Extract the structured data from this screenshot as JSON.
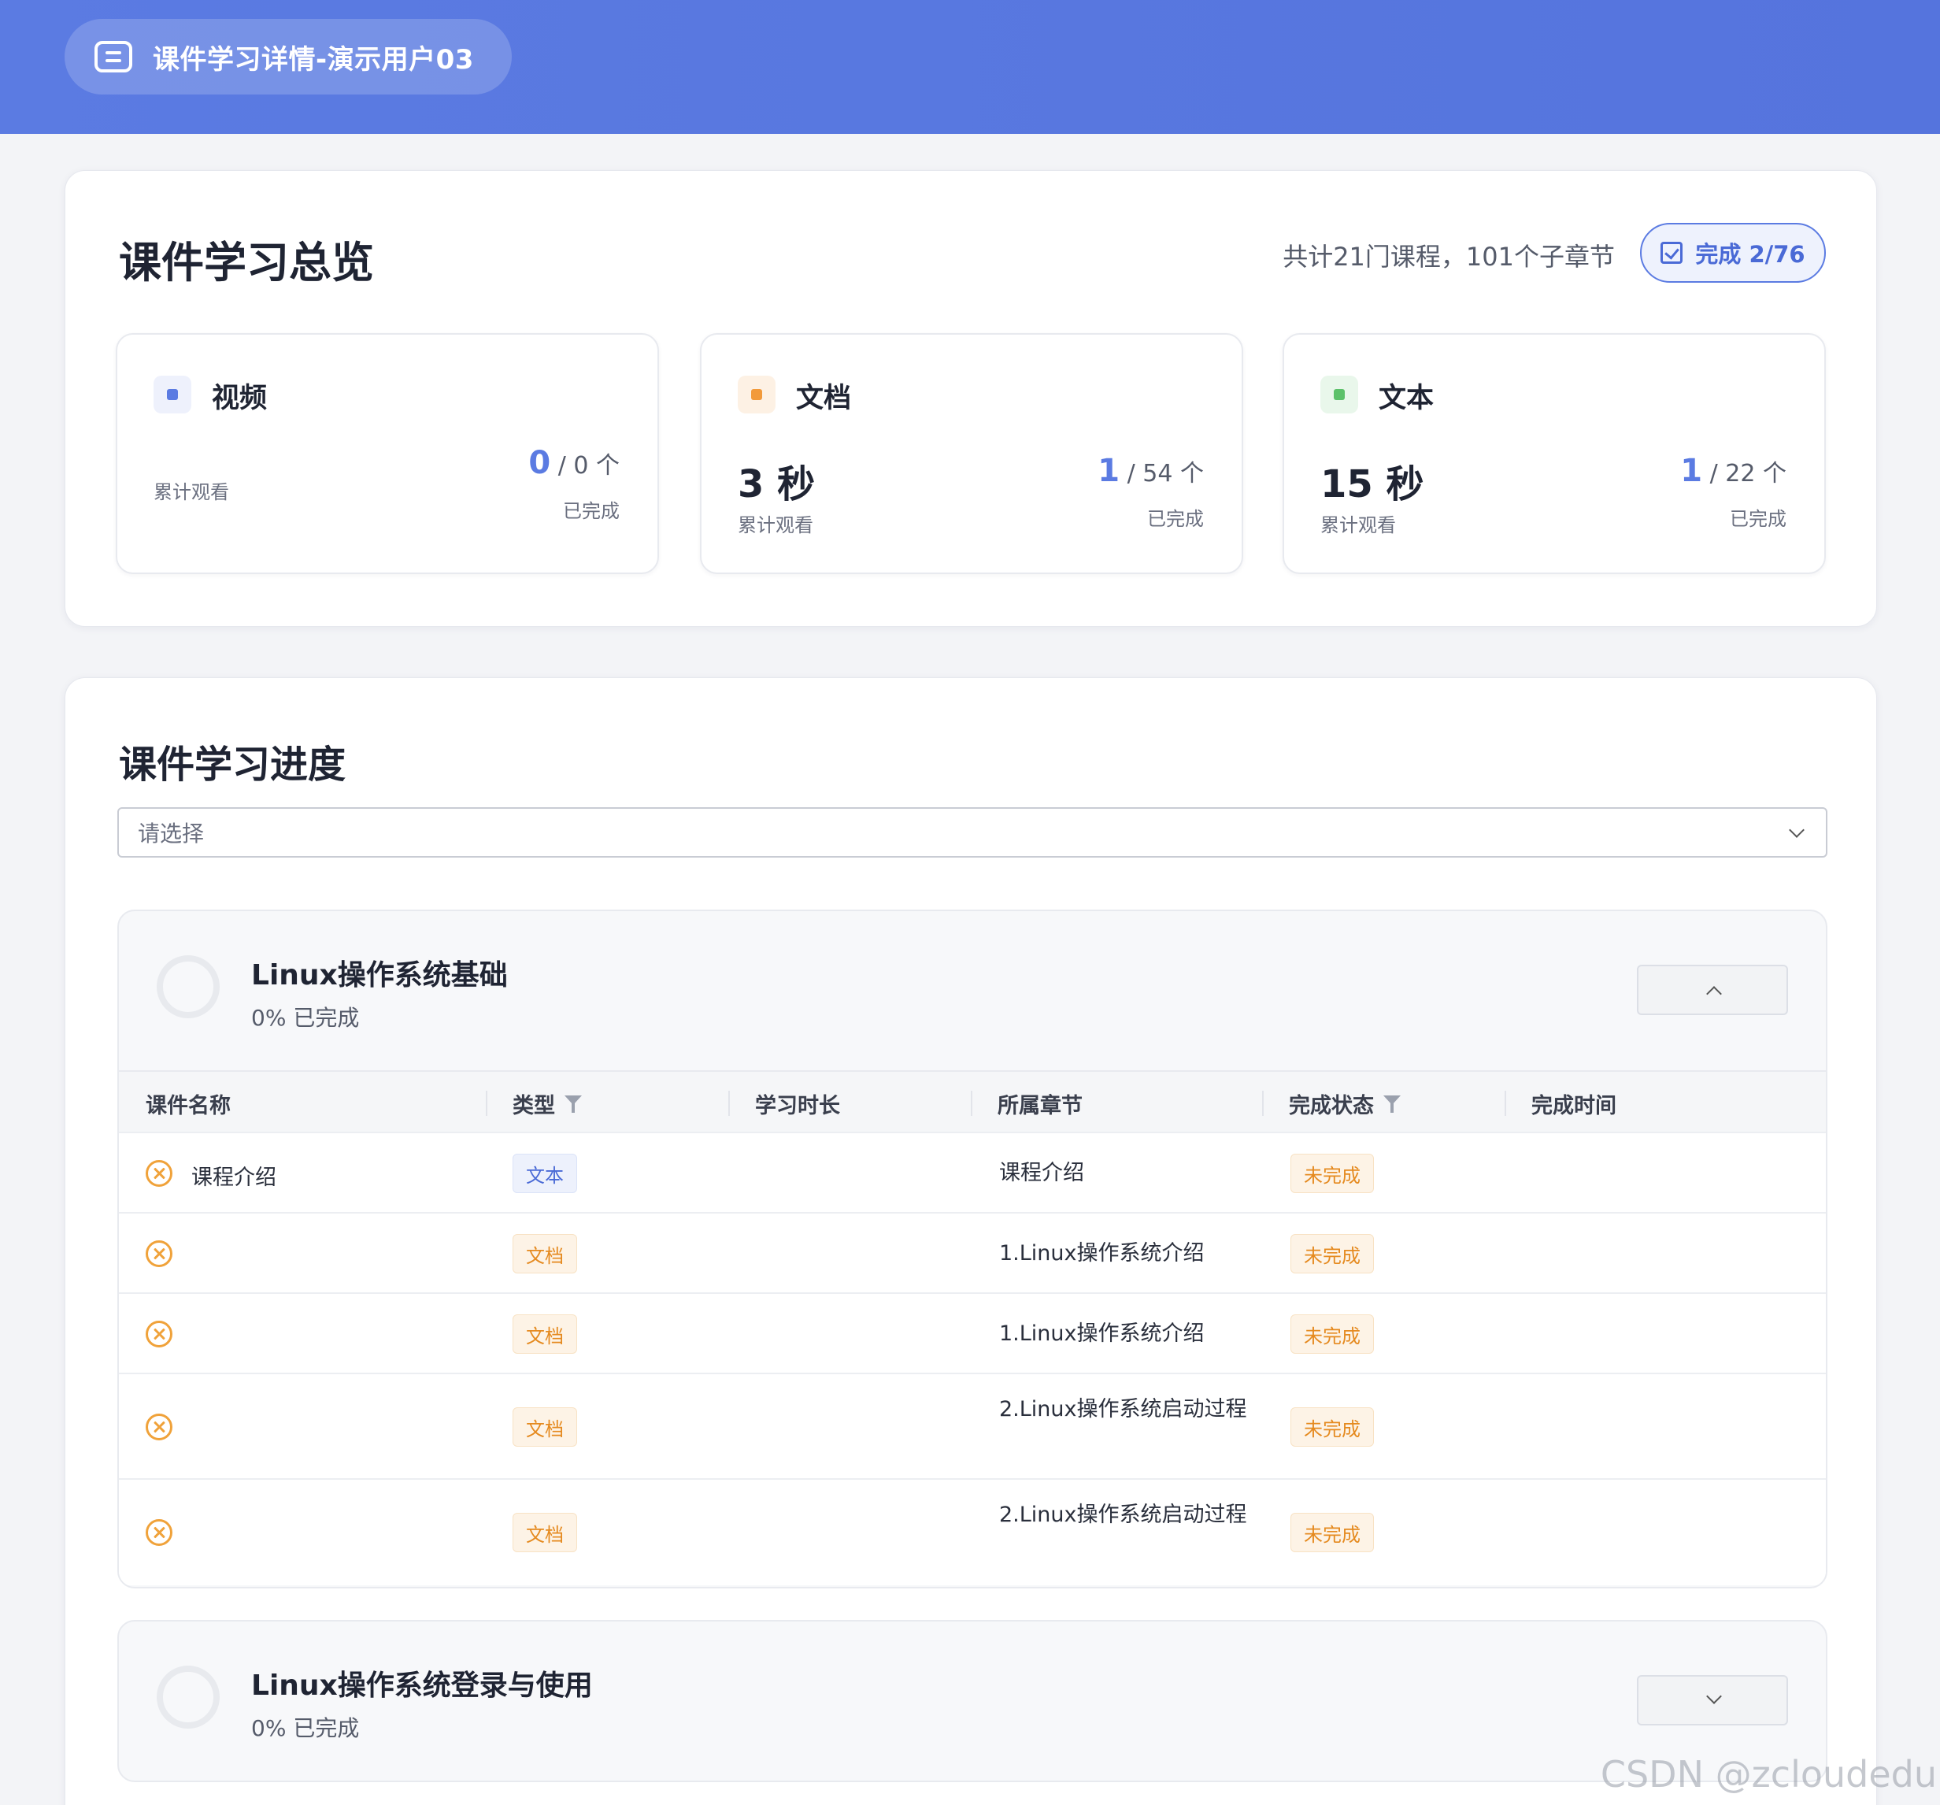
{
  "header": {
    "title": "课件学习详情-演示用户03"
  },
  "overview": {
    "title": "课件学习总览",
    "summary": "共计21门课程，101个子章节",
    "complete_button": "完成 2/76",
    "stats": [
      {
        "label": "视频",
        "time": "",
        "watch_label": "累计观看",
        "done": "0",
        "total": "/ 0 个",
        "done_label": "已完成",
        "icon_color": "#5b7be2",
        "icon_bg": "#eef1fc"
      },
      {
        "label": "文档",
        "time": "3 秒",
        "watch_label": "累计观看",
        "done": "1",
        "total": "/ 54 个",
        "done_label": "已完成",
        "icon_color": "#f29a3a",
        "icon_bg": "#fdf1e4"
      },
      {
        "label": "文本",
        "time": "15 秒",
        "watch_label": "累计观看",
        "done": "1",
        "total": "/ 22 个",
        "done_label": "已完成",
        "icon_color": "#5cc16a",
        "icon_bg": "#e9f7eb"
      }
    ]
  },
  "progress": {
    "title": "课件学习进度",
    "select_placeholder": "请选择",
    "columns": [
      "课件名称",
      "类型",
      "学习时长",
      "所属章节",
      "完成状态",
      "完成时间"
    ],
    "sections": [
      {
        "title": "Linux操作系统基础",
        "percent": "0% 已完成",
        "rows": [
          {
            "name": "课程介绍",
            "type": "文本",
            "duration": "",
            "chapter": "课程介绍",
            "status": "未完成",
            "time": ""
          },
          {
            "name": "",
            "type": "文档",
            "duration": "",
            "chapter": "1.Linux操作系统介绍",
            "status": "未完成",
            "time": ""
          },
          {
            "name": "",
            "type": "文档",
            "duration": "",
            "chapter": "1.Linux操作系统介绍",
            "status": "未完成",
            "time": ""
          },
          {
            "name": "",
            "type": "文档",
            "duration": "",
            "chapter": "2.Linux操作系统启动过程",
            "status": "未完成",
            "time": ""
          },
          {
            "name": "",
            "type": "文档",
            "duration": "",
            "chapter": "2.Linux操作系统启动过程",
            "status": "未完成",
            "time": ""
          }
        ]
      },
      {
        "title": "Linux操作系统登录与使用",
        "percent": "0% 已完成"
      }
    ]
  },
  "watermark": "CSDN @zcloudedu"
}
